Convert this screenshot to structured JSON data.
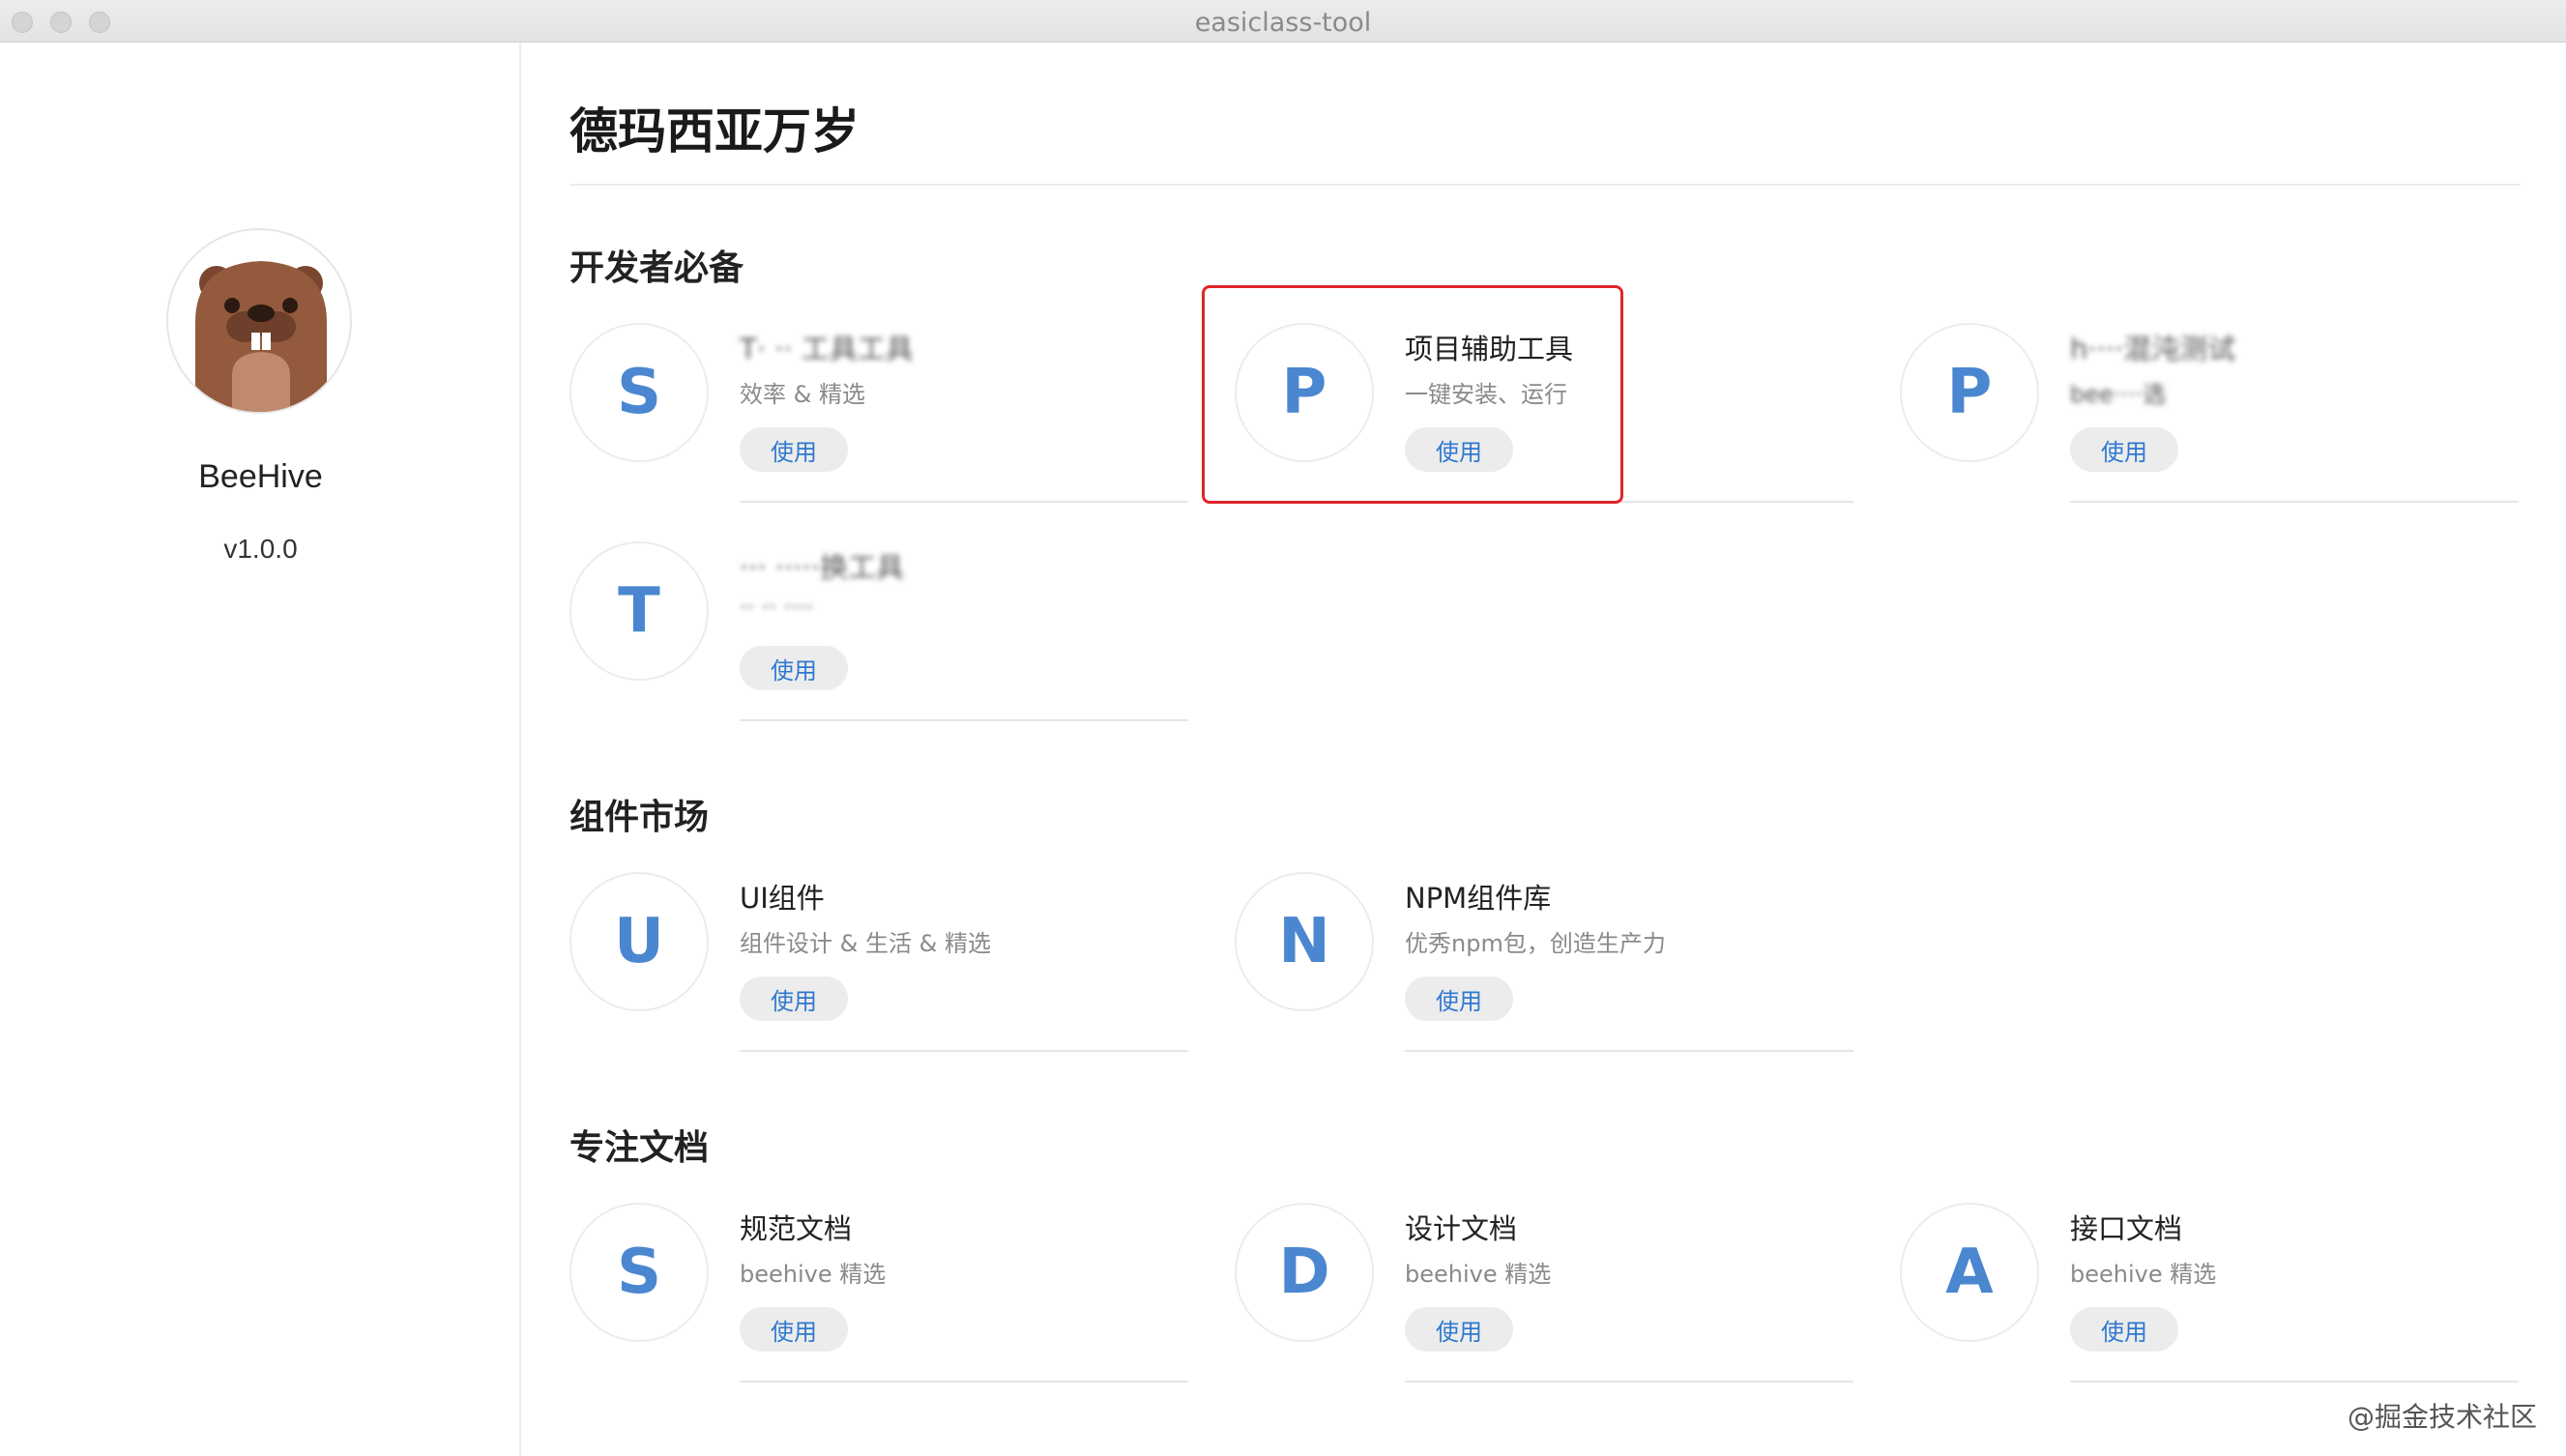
{
  "window": {
    "title": "easiclass-tool"
  },
  "sidebar": {
    "app_name": "BeeHive",
    "version": "v1.0.0"
  },
  "main": {
    "title": "德玛西亚万岁"
  },
  "sections": [
    {
      "title": "开发者必备",
      "cards": [
        {
          "letter": "S",
          "name": "T·  ·· 工具工具",
          "desc": "效率 & 精选",
          "button": "使用"
        },
        {
          "letter": "P",
          "name": "项目辅助工具",
          "desc": "一键安装、运行",
          "button": "使用"
        },
        {
          "letter": "P",
          "name": "h····混沌测试",
          "desc": "bee····选",
          "button": "使用"
        },
        {
          "letter": "T",
          "name": "···  ·····换工具",
          "desc": "·· ·· ····",
          "button": "使用"
        }
      ]
    },
    {
      "title": "组件市场",
      "cards": [
        {
          "letter": "U",
          "name": "UI组件",
          "desc": "组件设计 & 生活 & 精选",
          "button": "使用"
        },
        {
          "letter": "N",
          "name": "NPM组件库",
          "desc": "优秀npm包，创造生产力",
          "button": "使用"
        }
      ]
    },
    {
      "title": "专注文档",
      "cards": [
        {
          "letter": "S",
          "name": "规范文档",
          "desc": "beehive 精选",
          "button": "使用"
        },
        {
          "letter": "D",
          "name": "设计文档",
          "desc": "beehive 精选",
          "button": "使用"
        },
        {
          "letter": "A",
          "name": "接口文档",
          "desc": "beehive 精选",
          "button": "使用"
        }
      ]
    }
  ],
  "watermark": "@掘金技术社区",
  "colors": {
    "accent": "#4a87d0",
    "highlight": "#e0252b",
    "button_bg": "#ececec"
  }
}
